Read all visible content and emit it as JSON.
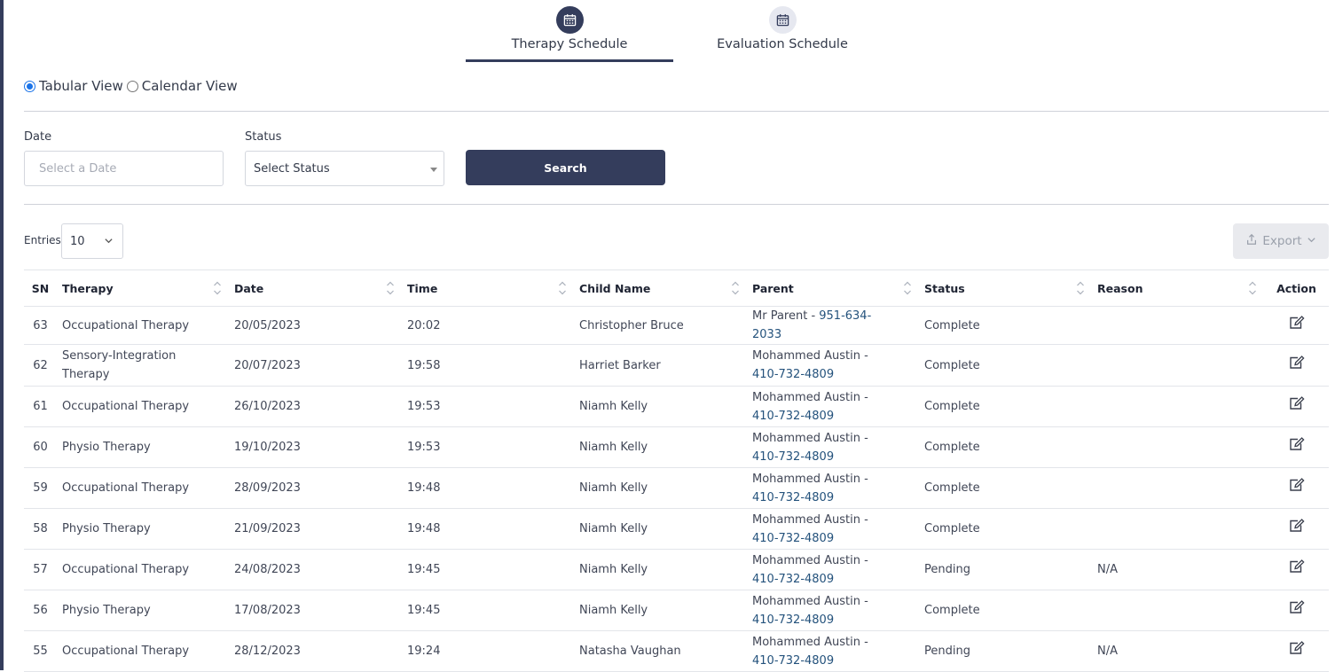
{
  "tabs": [
    {
      "label": "Therapy Schedule",
      "active": true
    },
    {
      "label": "Evaluation Schedule",
      "active": false
    }
  ],
  "view_toggle": {
    "tabular_label": "Tabular View",
    "calendar_label": "Calendar View",
    "selected": "tabular"
  },
  "filters": {
    "date_label": "Date",
    "date_placeholder": "Select a Date",
    "status_label": "Status",
    "status_value": "Select Status",
    "search_label": "Search"
  },
  "table_controls": {
    "entries_label": "Entries",
    "entries_value": "10",
    "export_label": "Export"
  },
  "table": {
    "columns": [
      "SN",
      "Therapy",
      "Date",
      "Time",
      "Child Name",
      "Parent",
      "Status",
      "Reason",
      "Action"
    ],
    "rows": [
      {
        "sn": "63",
        "therapy": "Occupational Therapy",
        "date": "20/05/2023",
        "time": "20:02",
        "child": "Christopher Bruce",
        "parent_name": "Mr Parent - ",
        "parent_phone": "951-634-2033",
        "status": "Complete",
        "reason": ""
      },
      {
        "sn": "62",
        "therapy": "Sensory-Integration Therapy",
        "date": "20/07/2023",
        "time": "19:58",
        "child": "Harriet Barker",
        "parent_name": "Mohammed Austin - ",
        "parent_phone": "410-732-4809",
        "status": "Complete",
        "reason": ""
      },
      {
        "sn": "61",
        "therapy": "Occupational Therapy",
        "date": "26/10/2023",
        "time": "19:53",
        "child": "Niamh Kelly",
        "parent_name": "Mohammed Austin - ",
        "parent_phone": "410-732-4809",
        "status": "Complete",
        "reason": ""
      },
      {
        "sn": "60",
        "therapy": "Physio Therapy",
        "date": "19/10/2023",
        "time": "19:53",
        "child": "Niamh Kelly",
        "parent_name": "Mohammed Austin - ",
        "parent_phone": "410-732-4809",
        "status": "Complete",
        "reason": ""
      },
      {
        "sn": "59",
        "therapy": "Occupational Therapy",
        "date": "28/09/2023",
        "time": "19:48",
        "child": "Niamh Kelly",
        "parent_name": "Mohammed Austin - ",
        "parent_phone": "410-732-4809",
        "status": "Complete",
        "reason": ""
      },
      {
        "sn": "58",
        "therapy": "Physio Therapy",
        "date": "21/09/2023",
        "time": "19:48",
        "child": "Niamh Kelly",
        "parent_name": "Mohammed Austin - ",
        "parent_phone": "410-732-4809",
        "status": "Complete",
        "reason": ""
      },
      {
        "sn": "57",
        "therapy": "Occupational Therapy",
        "date": "24/08/2023",
        "time": "19:45",
        "child": "Niamh Kelly",
        "parent_name": "Mohammed Austin - ",
        "parent_phone": "410-732-4809",
        "status": "Pending",
        "reason": "N/A"
      },
      {
        "sn": "56",
        "therapy": "Physio Therapy",
        "date": "17/08/2023",
        "time": "19:45",
        "child": "Niamh Kelly",
        "parent_name": "Mohammed Austin - ",
        "parent_phone": "410-732-4809",
        "status": "Complete",
        "reason": ""
      },
      {
        "sn": "55",
        "therapy": "Occupational Therapy",
        "date": "28/12/2023",
        "time": "19:24",
        "child": "Natasha Vaughan",
        "parent_name": "Mohammed Austin - ",
        "parent_phone": "410-732-4809",
        "status": "Pending",
        "reason": "N/A"
      }
    ]
  },
  "colors": {
    "primary": "#343d5c",
    "phone_link": "#24527c",
    "radio_accent": "#1a73e8"
  },
  "icons": {
    "tab": "calendar-icon",
    "export": "upload-icon",
    "action": "edit-icon"
  }
}
